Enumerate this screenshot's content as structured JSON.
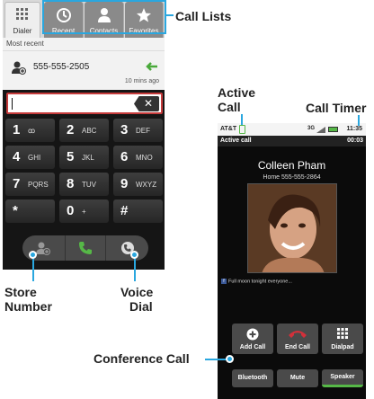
{
  "callouts": {
    "call_lists": "Call Lists",
    "active_call": [
      "Active",
      "Call"
    ],
    "call_timer": "Call Timer",
    "store_number": [
      "Store",
      "Number"
    ],
    "voice_dial": [
      "Voice",
      "Dial"
    ],
    "conference_call": "Conference Call"
  },
  "dialer": {
    "tabs": [
      {
        "label": "Dialer",
        "icon": "keypad-grid-icon"
      },
      {
        "label": "Recent",
        "icon": "recent-calls-icon"
      },
      {
        "label": "Contacts",
        "icon": "person-icon"
      },
      {
        "label": "Favorites",
        "icon": "star-icon"
      }
    ],
    "section_title": "Most recent",
    "recent": {
      "number": "555-555-2505",
      "time": "10 mins ago",
      "icon": "incoming-call-arrow-icon"
    },
    "input_value": "",
    "backspace": "✕",
    "keys": [
      {
        "digit": "1",
        "letters": "ꝏ"
      },
      {
        "digit": "2",
        "letters": "ABC"
      },
      {
        "digit": "3",
        "letters": "DEF"
      },
      {
        "digit": "4",
        "letters": "GHI"
      },
      {
        "digit": "5",
        "letters": "JKL"
      },
      {
        "digit": "6",
        "letters": "MNO"
      },
      {
        "digit": "7",
        "letters": "PQRS"
      },
      {
        "digit": "8",
        "letters": "TUV"
      },
      {
        "digit": "9",
        "letters": "WXYZ"
      },
      {
        "digit": "*",
        "letters": ""
      },
      {
        "digit": "0",
        "letters": "+"
      },
      {
        "digit": "#",
        "letters": ""
      }
    ]
  },
  "call": {
    "carrier": "AT&T",
    "network": "3G",
    "clock": "11:35",
    "status_label": "Active call",
    "timer": "00:03",
    "caller_name": "Colleen Pham",
    "caller_number": "Home 555-555-2864",
    "social_status": "Full moon tonight everyone...",
    "social_badge": "f",
    "buttons": [
      {
        "label": "Add Call",
        "icon": "add-call-icon"
      },
      {
        "label": "End Call",
        "icon": "end-call-icon"
      },
      {
        "label": "Dialpad",
        "icon": "dialpad-icon"
      }
    ],
    "toggles": [
      {
        "label": "Bluetooth",
        "active": false
      },
      {
        "label": "Mute",
        "active": false
      },
      {
        "label": "Speaker",
        "active": true
      }
    ]
  },
  "colors": {
    "accent": "#2aa7df",
    "call_green": "#56b847",
    "end_red": "#d2303a"
  }
}
